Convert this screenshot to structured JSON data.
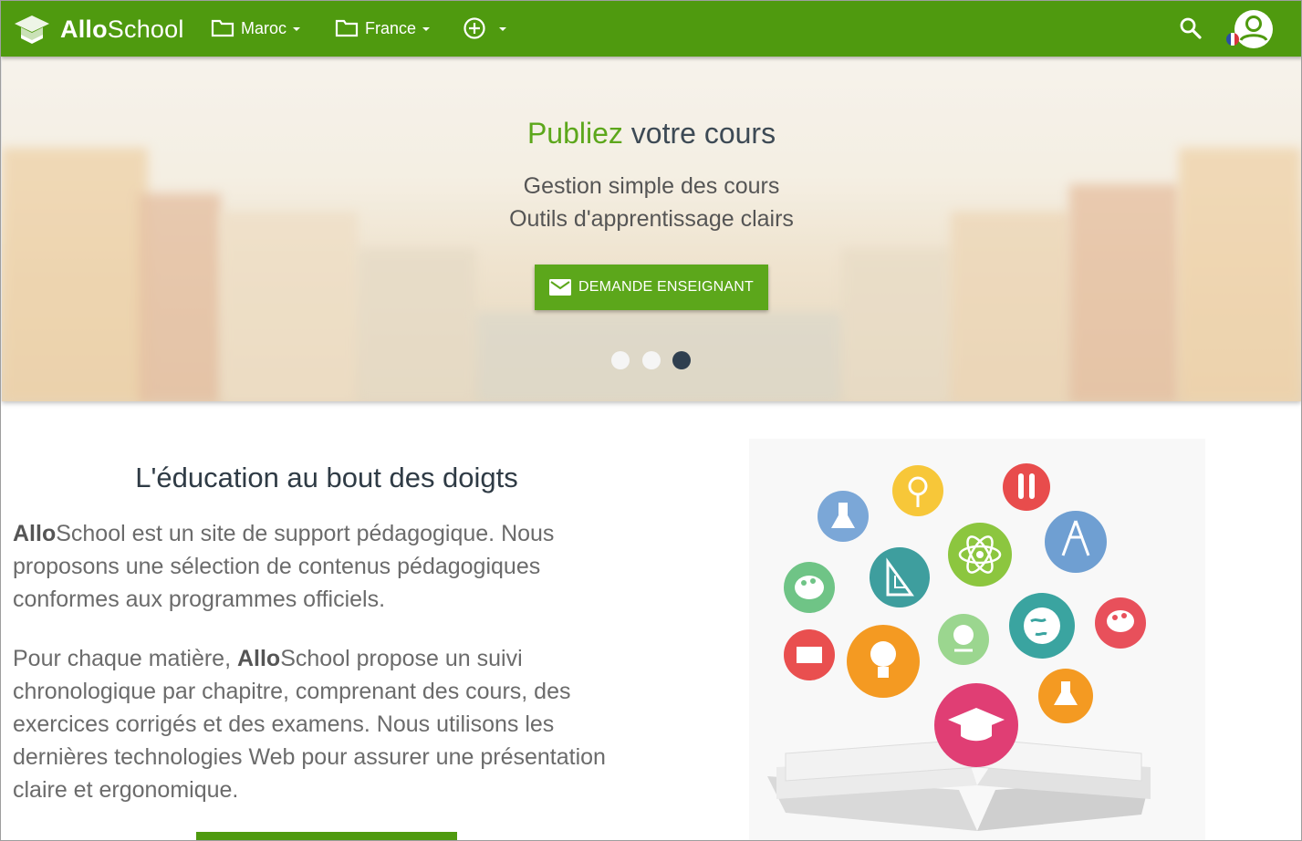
{
  "navbar": {
    "brand_bold": "Allo",
    "brand_rest": "School",
    "menu_maroc": "Maroc",
    "menu_france": "France",
    "add_icon": "plus-circle-icon",
    "search_icon": "search-icon",
    "account_icon": "account-circle-icon"
  },
  "hero": {
    "title_highlight": "Publiez",
    "title_rest": " votre cours",
    "line1": "Gestion simple des cours",
    "line2": "Outils d'apprentissage clairs",
    "button_label": "DEMANDE ENSEIGNANT",
    "slides_total": 3,
    "active_slide": 3
  },
  "about": {
    "title": "L'éducation au bout des doigts",
    "p1_bold": "Allo",
    "p1_rest": "School est un site de support pédagogique. Nous proposons une sélection de contenus pédagogiques conformes aux programmes officiels.",
    "p2_start": "Pour chaque matière, ",
    "p2_bold": "Allo",
    "p2_rest": "School propose un suivi chronologique par chapitre, comprenant des cours, des exercices corrigés et des examens. Nous utilisons les dernières technologies Web pour assurer une présentation claire et ergonomique."
  },
  "colors": {
    "primary": "#4f9a0f",
    "accent": "#5ca71b",
    "dot_active": "#2f3f4f"
  }
}
